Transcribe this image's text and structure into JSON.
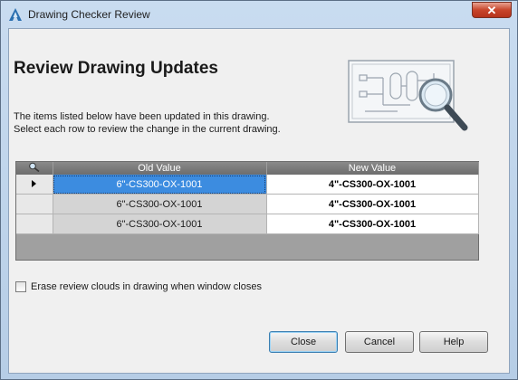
{
  "window": {
    "title": "Drawing Checker Review"
  },
  "heading": "Review Drawing Updates",
  "description": {
    "line1": "The items listed below have been updated in this drawing.",
    "line2": "Select each row to review the change in the current drawing."
  },
  "grid": {
    "columns": {
      "old": "Old Value",
      "new": "New Value"
    },
    "rows": [
      {
        "old": "6\"-CS300-OX-1001",
        "new": "4\"-CS300-OX-1001",
        "selected": true
      },
      {
        "old": "6\"-CS300-OX-1001",
        "new": "4\"-CS300-OX-1001",
        "selected": false
      },
      {
        "old": "6\"-CS300-OX-1001",
        "new": "4\"-CS300-OX-1001",
        "selected": false
      }
    ]
  },
  "erase_checkbox": {
    "label": "Erase review clouds in drawing when window closes",
    "checked": false
  },
  "buttons": {
    "close": "Close",
    "cancel": "Cancel",
    "help": "Help"
  },
  "icons": {
    "app": "autocad-logo-icon",
    "close": "close-icon",
    "illustration": "drawing-magnifier-icon",
    "header_magnifier": "magnifier-icon",
    "current_row": "row-pointer-icon"
  },
  "colors": {
    "selection": "#3c8ce0",
    "close_button": "#c8452b",
    "header": "#6d6d6d"
  }
}
